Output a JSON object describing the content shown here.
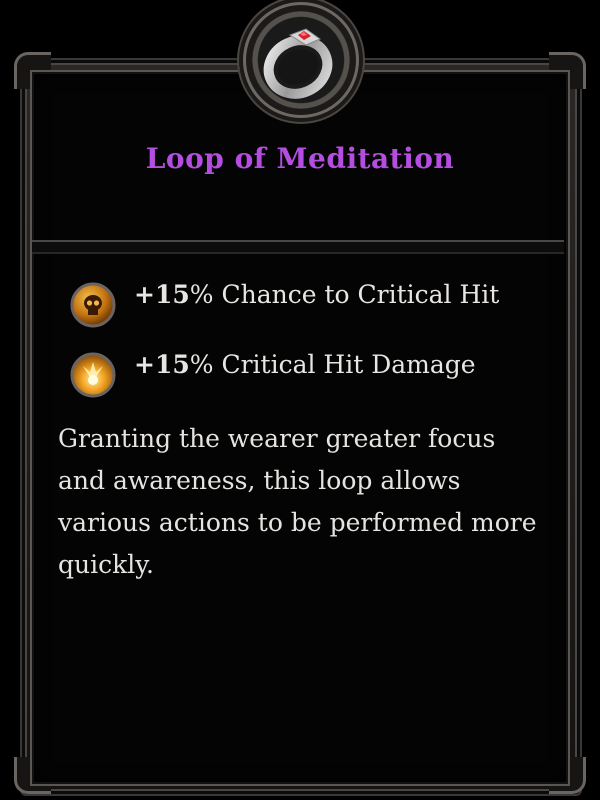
{
  "item": {
    "name": "Loop of Meditation",
    "name_color": "#b44ee0",
    "icon": "silver-ring-with-red-gem-icon",
    "stats": [
      {
        "value": "+15",
        "unit": "%",
        "label": "Chance to Critical Hit",
        "icon": "skull-medallion-icon"
      },
      {
        "value": "+15",
        "unit": "%",
        "label": "Critical Hit Damage",
        "icon": "burst-medallion-icon"
      }
    ],
    "description": "Granting the wearer greater focus and awareness, this loop allows various actions to be performed more quickly."
  }
}
